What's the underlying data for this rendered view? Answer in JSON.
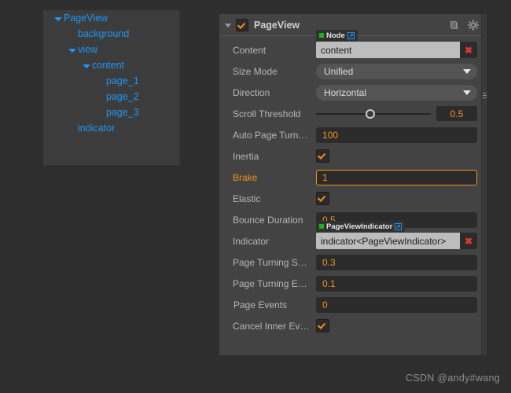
{
  "tree": {
    "items": [
      {
        "label": "PageView",
        "indent": 0,
        "expandable": true
      },
      {
        "label": "background",
        "indent": 1,
        "expandable": false
      },
      {
        "label": "view",
        "indent": 1,
        "expandable": true
      },
      {
        "label": "content",
        "indent": 2,
        "expandable": true
      },
      {
        "label": "page_1",
        "indent": 3,
        "expandable": false
      },
      {
        "label": "page_2",
        "indent": 3,
        "expandable": false
      },
      {
        "label": "page_3",
        "indent": 3,
        "expandable": false
      },
      {
        "label": "indicator",
        "indent": 1,
        "expandable": false
      }
    ]
  },
  "inspector": {
    "title": "PageView",
    "enabled_checkbox": true,
    "help_icon": "book-icon",
    "settings_icon": "gear-icon",
    "rows": {
      "content": {
        "label": "Content",
        "value": "content",
        "tag": "Node",
        "type": "node-ref"
      },
      "size_mode": {
        "label": "Size Mode",
        "value": "Unified",
        "type": "dropdown"
      },
      "direction": {
        "label": "Direction",
        "value": "Horizontal",
        "type": "dropdown"
      },
      "scroll_threshold": {
        "label": "Scroll Threshold",
        "value": "0.5",
        "type": "slider",
        "percent": 47
      },
      "auto_page_turn": {
        "label": "Auto Page Turn…",
        "value": "100",
        "type": "number"
      },
      "inertia": {
        "label": "Inertia",
        "value": true,
        "type": "checkbox"
      },
      "brake": {
        "label": "Brake",
        "value": "1",
        "type": "number",
        "focused": true
      },
      "elastic": {
        "label": "Elastic",
        "value": true,
        "type": "checkbox"
      },
      "bounce_duration": {
        "label": "Bounce Duration",
        "value": "0.5",
        "type": "number"
      },
      "indicator": {
        "label": "Indicator",
        "value": "indicator<PageViewIndicator>",
        "tag": "PageViewIndicator",
        "type": "node-ref"
      },
      "page_turning_speed": {
        "label": "Page Turning S…",
        "value": "0.3",
        "type": "number"
      },
      "page_turning_ease": {
        "label": "Page Turning E…",
        "value": "0.1",
        "type": "number"
      },
      "page_events": {
        "label": "Page Events",
        "value": "0",
        "type": "number",
        "expandable": true
      },
      "cancel_inner_events": {
        "label": "Cancel Inner Ev…",
        "value": true,
        "type": "checkbox"
      }
    }
  },
  "watermark": "CSDN @andy#wang",
  "colors": {
    "accent": "#f0921e",
    "tree_text": "#2196f3",
    "panel_bg": "#434343",
    "tree_bg": "#3c3c3c",
    "page_bg": "#2e2e2e",
    "tag_green": "#19b319",
    "delete_red": "#d63b32"
  }
}
